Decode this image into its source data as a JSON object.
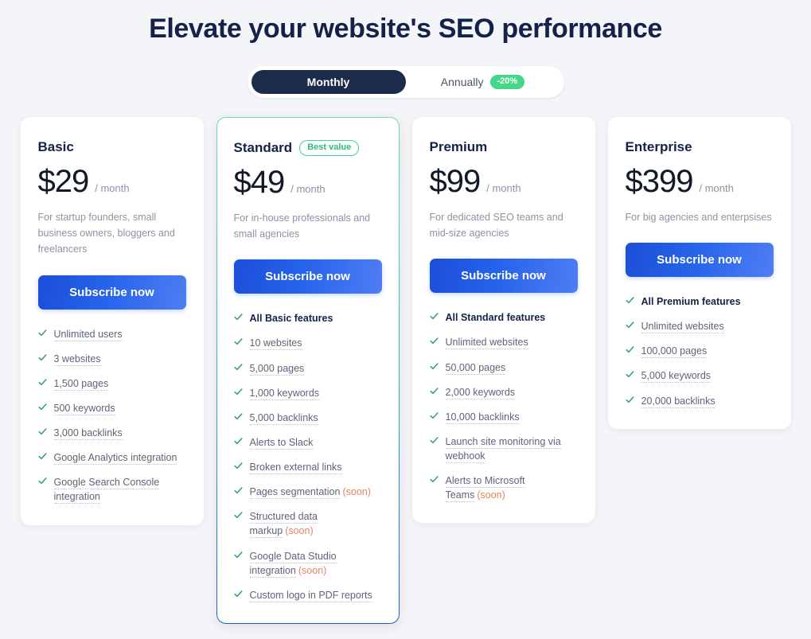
{
  "header": {
    "title": "Elevate your website's SEO performance"
  },
  "billing_toggle": {
    "monthly_label": "Monthly",
    "annually_label": "Annually",
    "discount_badge": "-20%",
    "active": "Monthly"
  },
  "colors": {
    "background": "#f4f5f8",
    "title": "#14224a",
    "accent_blue": "#2563eb",
    "accent_green": "#43d787",
    "soon_orange": "#e8855c",
    "toggle_active_bg": "#1c2b4a",
    "muted_text": "#8b93a3"
  },
  "plans": [
    {
      "name": "Basic",
      "badge": null,
      "price": "$29",
      "period": "/ month",
      "description": "For startup founders, small business owners, bloggers and freelancers",
      "cta": "Subscribe now",
      "featured": false,
      "features": [
        {
          "text": "Unlimited users",
          "bold": false,
          "soon": null
        },
        {
          "text": "3 websites",
          "bold": false,
          "soon": null
        },
        {
          "text": "1,500 pages",
          "bold": false,
          "soon": null
        },
        {
          "text": "500 keywords",
          "bold": false,
          "soon": null
        },
        {
          "text": "3,000 backlinks",
          "bold": false,
          "soon": null
        },
        {
          "text": "Google Analytics integration",
          "bold": false,
          "soon": null
        },
        {
          "text": "Google Search Console integration",
          "bold": false,
          "soon": null
        }
      ]
    },
    {
      "name": "Standard",
      "badge": "Best value",
      "price": "$49",
      "period": "/ month",
      "description": "For in-house professionals and small agencies",
      "cta": "Subscribe now",
      "featured": true,
      "features": [
        {
          "text": "All Basic features",
          "bold": true,
          "soon": null
        },
        {
          "text": "10 websites",
          "bold": false,
          "soon": null
        },
        {
          "text": "5,000 pages",
          "bold": false,
          "soon": null
        },
        {
          "text": "1,000 keywords",
          "bold": false,
          "soon": null
        },
        {
          "text": "5,000 backlinks",
          "bold": false,
          "soon": null
        },
        {
          "text": "Alerts to Slack",
          "bold": false,
          "soon": null
        },
        {
          "text": "Broken external links",
          "bold": false,
          "soon": null
        },
        {
          "text": "Pages segmentation",
          "bold": false,
          "soon": "(soon)"
        },
        {
          "text": "Structured data markup",
          "bold": false,
          "soon": "(soon)"
        },
        {
          "text": "Google Data Studio integration",
          "bold": false,
          "soon": "(soon)"
        },
        {
          "text": "Custom logo in PDF reports",
          "bold": false,
          "soon": null
        }
      ]
    },
    {
      "name": "Premium",
      "badge": null,
      "price": "$99",
      "period": "/ month",
      "description": "For dedicated SEO teams and mid-size agencies",
      "cta": "Subscribe now",
      "featured": false,
      "features": [
        {
          "text": "All Standard features",
          "bold": true,
          "soon": null
        },
        {
          "text": "Unlimited websites",
          "bold": false,
          "soon": null
        },
        {
          "text": "50,000 pages",
          "bold": false,
          "soon": null
        },
        {
          "text": "2,000 keywords",
          "bold": false,
          "soon": null
        },
        {
          "text": "10,000 backlinks",
          "bold": false,
          "soon": null
        },
        {
          "text": "Launch site monitoring via webhook",
          "bold": false,
          "soon": null
        },
        {
          "text": "Alerts to Microsoft Teams",
          "bold": false,
          "soon": "(soon)"
        }
      ]
    },
    {
      "name": "Enterprise",
      "badge": null,
      "price": "$399",
      "period": "/ month",
      "description": "For big agencies and enterpsises",
      "cta": "Subscribe now",
      "featured": false,
      "features": [
        {
          "text": "All Premium features",
          "bold": true,
          "soon": null
        },
        {
          "text": "Unlimited websites",
          "bold": false,
          "soon": null
        },
        {
          "text": "100,000 pages",
          "bold": false,
          "soon": null
        },
        {
          "text": "5,000 keywords",
          "bold": false,
          "soon": null
        },
        {
          "text": "20,000 backlinks",
          "bold": false,
          "soon": null
        }
      ]
    }
  ]
}
